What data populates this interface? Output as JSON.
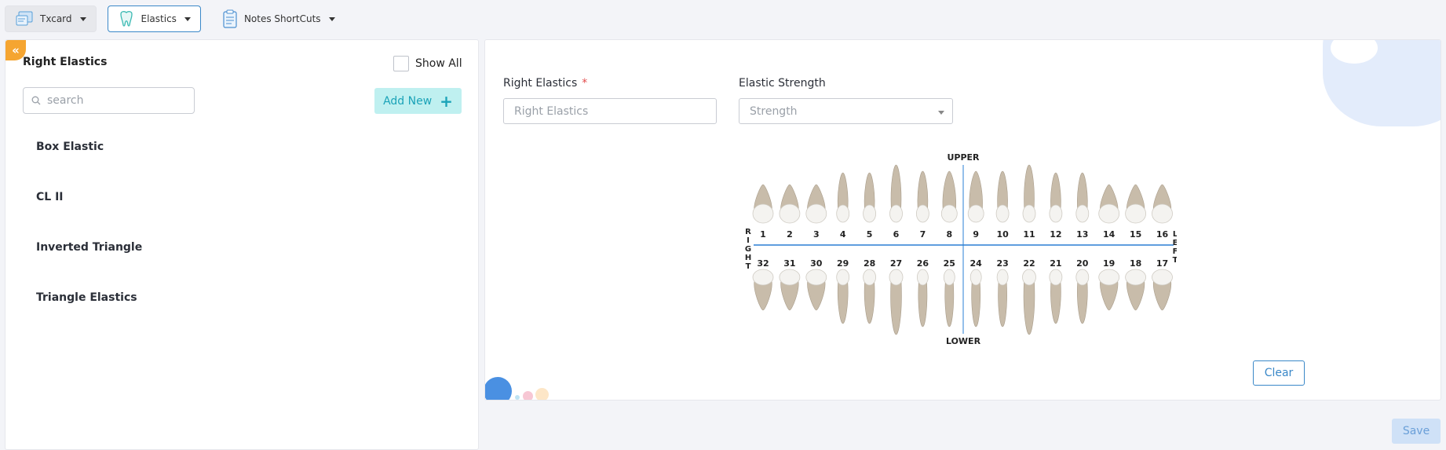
{
  "toolbar": {
    "txcard_label": "Txcard",
    "elastics_label": "Elastics",
    "notes_label": "Notes ShortCuts"
  },
  "left_panel": {
    "title": "Right Elastics",
    "show_all_label": "Show All",
    "search_placeholder": "search",
    "add_new_label": "Add New",
    "items": [
      "Box Elastic",
      "CL II",
      "Inverted Triangle",
      "Triangle Elastics"
    ]
  },
  "form": {
    "right_elastics_label": "Right Elastics",
    "required_mark": "*",
    "right_elastics_placeholder": "Right Elastics",
    "strength_label": "Elastic Strength",
    "strength_placeholder": "Strength"
  },
  "tooth_chart": {
    "upper_label": "UPPER",
    "lower_label": "LOWER",
    "right_label": "RIGHT",
    "left_label": "LEFT",
    "upper_teeth": [
      "1",
      "2",
      "3",
      "4",
      "5",
      "6",
      "7",
      "8",
      "9",
      "10",
      "11",
      "12",
      "13",
      "14",
      "15",
      "16"
    ],
    "lower_teeth": [
      "32",
      "31",
      "30",
      "29",
      "28",
      "27",
      "26",
      "25",
      "24",
      "23",
      "22",
      "21",
      "20",
      "19",
      "18",
      "17"
    ]
  },
  "buttons": {
    "clear_label": "Clear",
    "save_label": "Save"
  },
  "colors": {
    "accent": "#3a88c8",
    "collapse": "#f5a531",
    "add_new_bg": "#bff0f0",
    "add_new_text": "#1ba3b8",
    "chart_line": "#2a7fd4"
  }
}
